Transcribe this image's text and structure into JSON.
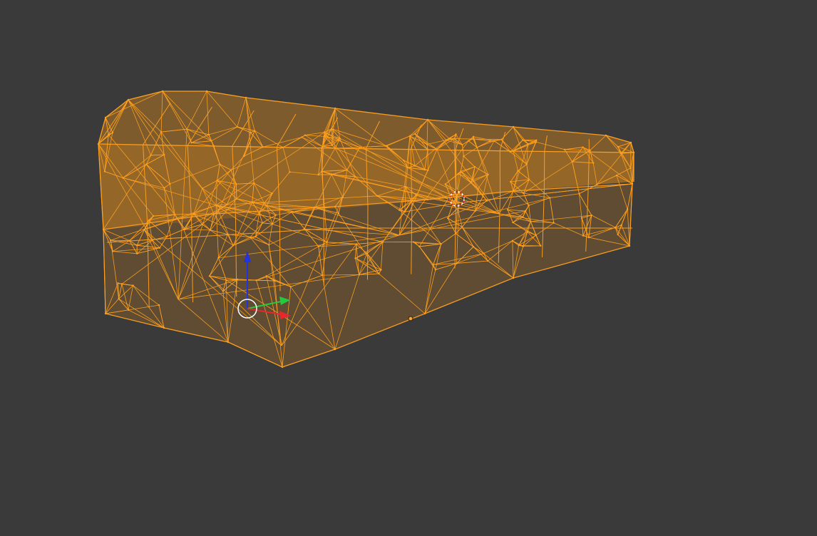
{
  "viewport": {
    "background_color": "#3a3a3a",
    "view_mode": "wireframe",
    "selected_object": {
      "selected": true,
      "wire_color": "#ffa020",
      "face_color": "#ff9a14",
      "face_opacity": 0.35
    },
    "gizmo": {
      "x_axis_color": "#e8262b",
      "y_axis_color": "#25c93c",
      "z_axis_color": "#2233e0",
      "ring_color": "#ffffff"
    },
    "markers": [
      {
        "name": "3d-cursor",
        "icon": "crosshair-ring"
      },
      {
        "name": "object-origin",
        "icon": "dot"
      }
    ]
  }
}
